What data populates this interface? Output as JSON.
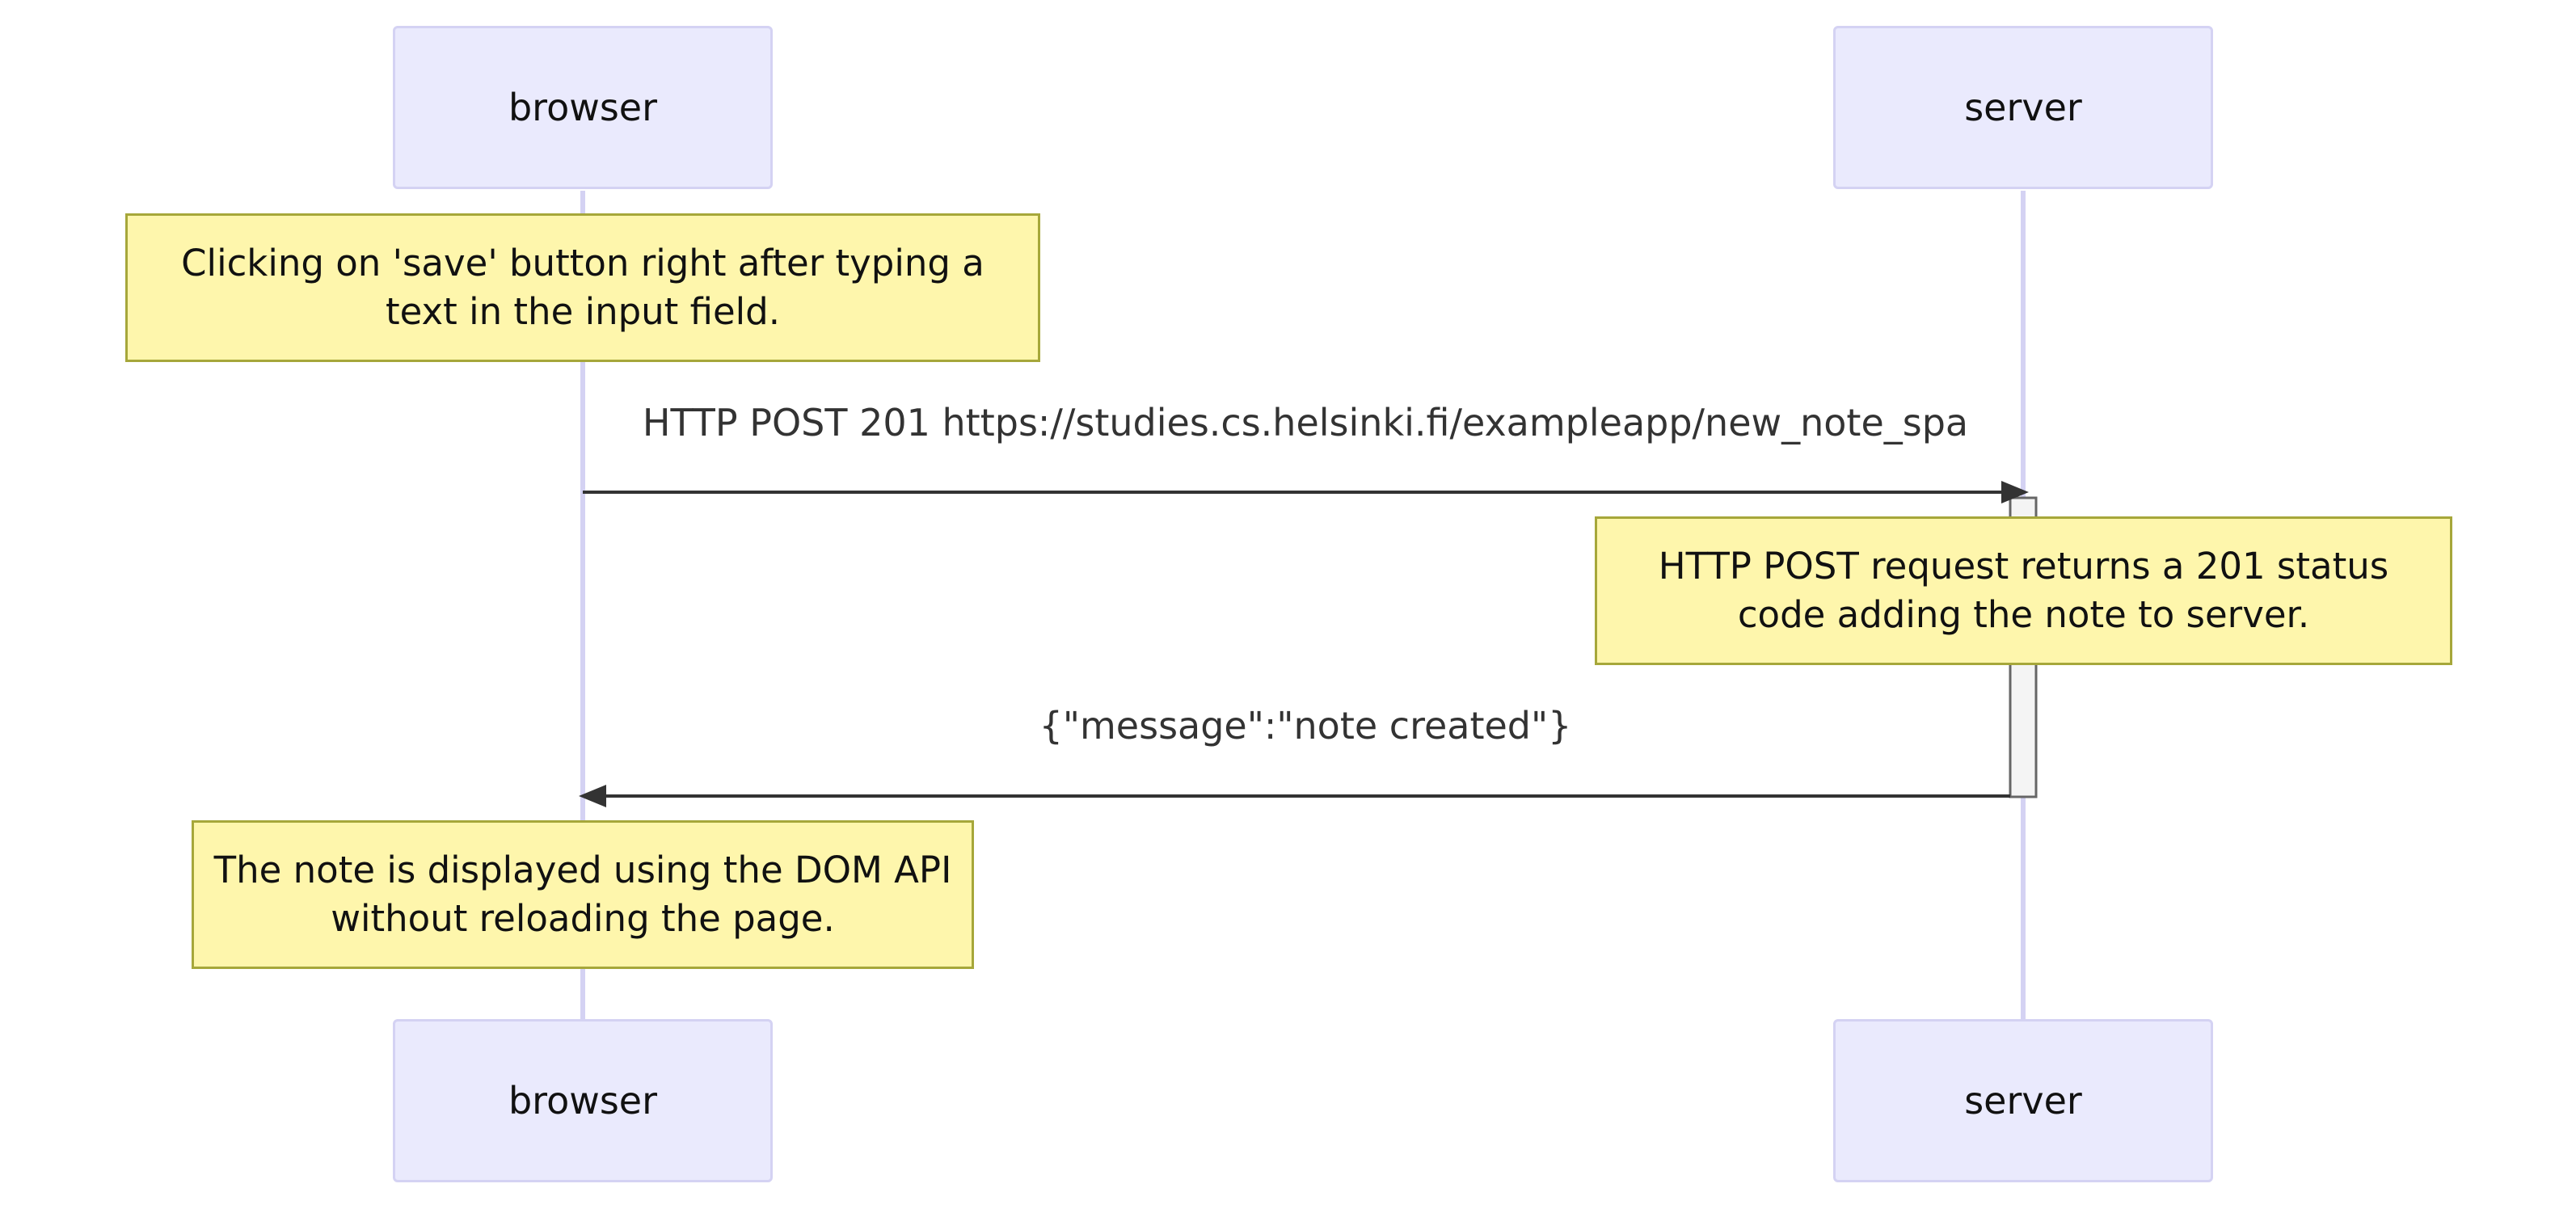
{
  "participants": {
    "left": "browser",
    "right": "server"
  },
  "notes": [
    "Clicking on 'save' button right after typing a text in the input field.",
    "HTTP POST request returns a 201 status code adding the note to server.",
    "The note is displayed using the DOM API without reloading the page."
  ],
  "messages": [
    {
      "from": "browser",
      "to": "server",
      "label": "HTTP POST 201 https://studies.cs.helsinki.fi/exampleapp/new_note_spa"
    },
    {
      "from": "server",
      "to": "browser",
      "label": "{\"message\":\"note created\"}"
    }
  ],
  "colors": {
    "actor_fill": "#eaeafd",
    "actor_border": "#d4d2f3",
    "lifeline": "#d4d2f3",
    "note_fill": "#fef6ac",
    "note_border": "#a6a73a",
    "arrow": "#333333",
    "activation_fill": "#f4f4f4"
  }
}
